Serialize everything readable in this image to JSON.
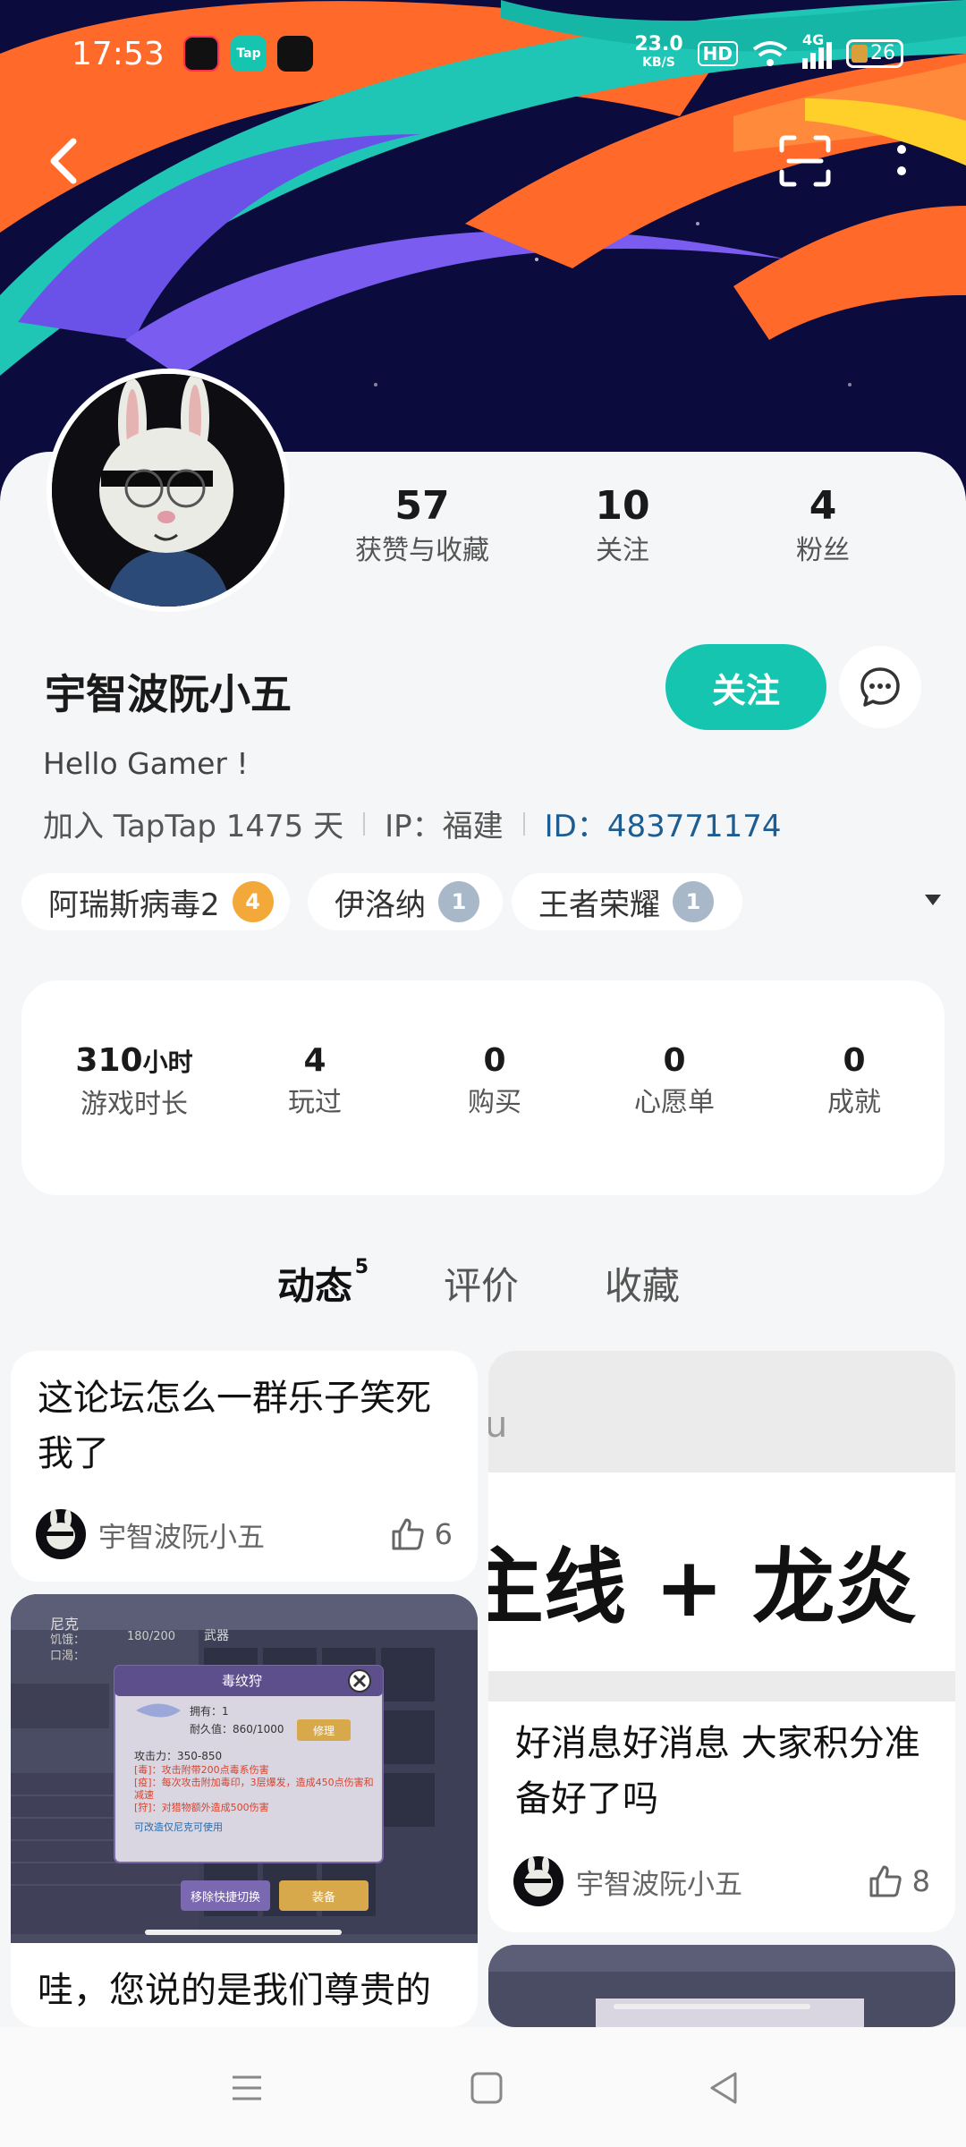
{
  "status_bar": {
    "time": "17:53",
    "net_speed_value": "23.0",
    "net_speed_unit": "KB/S",
    "hd_label": "HD",
    "network_label": "4G",
    "battery_level": "26"
  },
  "header": {
    "back_icon": "chevron-left-icon",
    "scan_icon": "scan-icon",
    "more_icon": "more-vertical-icon"
  },
  "profile": {
    "stats": [
      {
        "value": "57",
        "label": "获赞与收藏"
      },
      {
        "value": "10",
        "label": "关注"
      },
      {
        "value": "4",
        "label": "粉丝"
      }
    ],
    "username": "宇智波阮小五",
    "follow_label": "关注",
    "bio": "Hello Gamer !",
    "join_info": "加入 TapTap 1475 天",
    "ip_info": "IP：福建",
    "id_label": "ID：",
    "id_value": "483771174",
    "tags": [
      {
        "name": "阿瑞斯病毒2",
        "level": "4"
      },
      {
        "name": "伊洛纳",
        "level": "1"
      },
      {
        "name": "王者荣耀",
        "level": "1"
      }
    ]
  },
  "game_stats": [
    {
      "value": "310",
      "unit": "小时",
      "label": "游戏时长"
    },
    {
      "value": "4",
      "unit": "",
      "label": "玩过"
    },
    {
      "value": "0",
      "unit": "",
      "label": "购买"
    },
    {
      "value": "0",
      "unit": "",
      "label": "心愿单"
    },
    {
      "value": "0",
      "unit": "",
      "label": "成就"
    }
  ],
  "tabs": [
    {
      "label": "动态",
      "count": "5"
    },
    {
      "label": "评价",
      "count": ""
    },
    {
      "label": "收藏",
      "count": ""
    }
  ],
  "feed": {
    "post1": {
      "title": "这论坛怎么一群乐子笑死我了",
      "author": "宇智波阮小五",
      "likes": "6"
    },
    "post2": {
      "banner_text": "主线 + 龙炎",
      "banner_partial": "u",
      "title": "好消息好消息 大家积分准备好了吗",
      "author": "宇智波阮小五",
      "likes": "8"
    },
    "post3": {
      "title": "哇，您说的是我们尊贵的",
      "shot": {
        "char_name": "尼克",
        "hunger": "饥饿：",
        "hunger_val": "180/200",
        "thirst": "口渴：",
        "weapon": "武器",
        "item_name": "毒纹狩",
        "owned": "拥有：1",
        "durability": "耐久值：860/1000",
        "repair": "修理",
        "attack": "攻击力：350-850",
        "line1": "[毒]：攻击附带200点毒系伤害",
        "line2": "[疫]：每次攻击附加毒印，3层爆发，造成450点伤害和减速",
        "line3": "[狩]：对猎物额外造成500伤害",
        "line4": "可改造仅尼克可使用",
        "remove_btn": "移除快捷切换",
        "equip_btn": "装备"
      }
    }
  }
}
